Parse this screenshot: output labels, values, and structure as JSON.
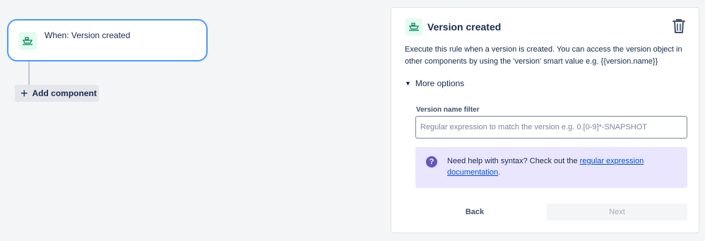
{
  "canvas": {
    "trigger": {
      "label": "When: Version created",
      "icon": "ship-icon"
    },
    "add_component_label": "Add component"
  },
  "panel": {
    "title": "Version created",
    "description": "Execute this rule when a version is created. You can access the version object in other components by using the 'version' smart value e.g. {{version.name}}",
    "more_options_label": "More options",
    "field": {
      "label": "Version name filter",
      "value": "",
      "placeholder": "Regular expression to match the version e.g. 0.[0-9]*-SNAPSHOT"
    },
    "help": {
      "text": "Need help with syntax? Check out the ",
      "link_text": "regular expression documentation",
      "suffix": "."
    },
    "back_label": "Back",
    "next_label": "Next"
  },
  "colors": {
    "accent": "#4c9aff",
    "icon_bg": "#e3fcef",
    "icon_fg": "#00875a",
    "help_bg": "#eae6ff",
    "help_icon": "#6554c0",
    "link": "#0052cc"
  }
}
